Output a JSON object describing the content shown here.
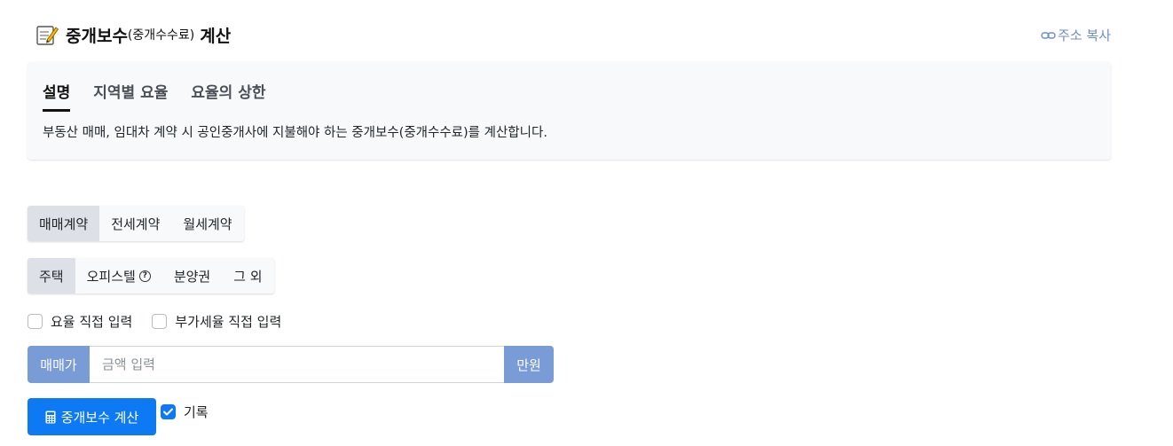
{
  "header": {
    "title_main": "중개보수",
    "title_sub": "(중개수수료)",
    "title_tail": "계산",
    "copy_link_label": "주소 복사"
  },
  "info": {
    "tabs": [
      {
        "label": "설명",
        "active": true
      },
      {
        "label": "지역별 요율",
        "active": false
      },
      {
        "label": "요율의 상한",
        "active": false
      }
    ],
    "description": "부동산 매매, 임대차 계약 시 공인중개사에 지불해야 하는 중개보수(중개수수료)를 계산합니다."
  },
  "contract_types": [
    "매매계약",
    "전세계약",
    "월세계약"
  ],
  "contract_selected": "매매계약",
  "property_types": [
    "주택",
    "오피스텔",
    "분양권",
    "그 외"
  ],
  "property_selected": "주택",
  "options": {
    "rate_direct": "요율 직접 입력",
    "vat_direct": "부가세율 직접 입력"
  },
  "amount": {
    "prefix": "매매가",
    "placeholder": "금액 입력",
    "value": "",
    "unit": "만원"
  },
  "calc_button": "중개보수 계산",
  "record": {
    "label": "기록",
    "checked": true
  },
  "colors": {
    "primary": "#0d79f2",
    "addon": "#7a9cd6",
    "link": "#6e8fc6",
    "card_bg": "#f8f9fa"
  },
  "icons": {
    "title": "memo-icon",
    "copy": "link-icon",
    "help": "question-circle-icon",
    "calc": "calculator-icon",
    "record": "check-icon"
  }
}
